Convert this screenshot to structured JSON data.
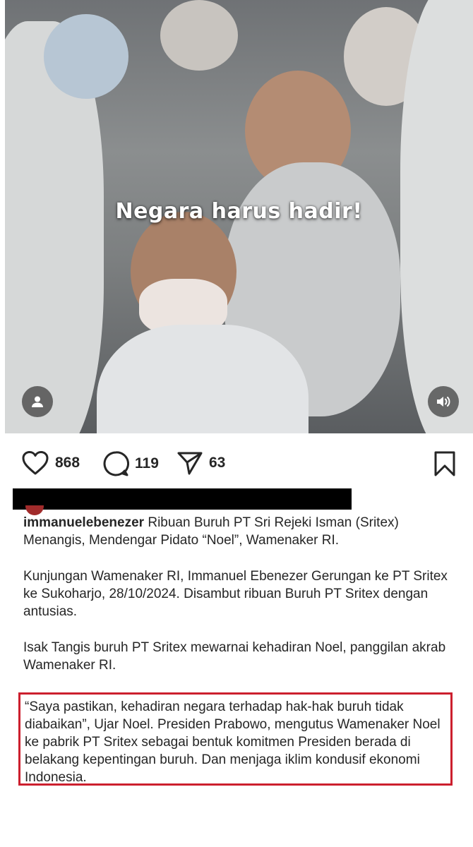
{
  "post": {
    "overlay_text": "Negara harus hadir!",
    "likes": "868",
    "comments": "119",
    "shares": "63"
  },
  "icons": {
    "like": "heart-icon",
    "comment": "comment-icon",
    "share": "send-icon",
    "save": "bookmark-icon",
    "user": "user-icon",
    "audio": "speaker-icon"
  },
  "caption": {
    "username": "immanuelebenezer",
    "text": "Ribuan Buruh PT Sri Rejeki Isman (Sritex) Menangis, Mendengar Pidato “Noel”, Wamenaker RI.",
    "paragraph2": "Kunjungan Wamenaker RI, Immanuel Ebenezer Gerungan ke PT Sritex ke Sukoharjo, 28/10/2024. Disambut ribuan Buruh PT Sritex dengan antusias.",
    "paragraph3": "Isak Tangis buruh PT Sritex mewarnai kehadiran Noel, panggilan akrab Wamenaker RI.",
    "quote": "“Saya pastikan, kehadiran negara terhadap hak-hak buruh tidak diabaikan”, Ujar Noel. Presiden Prabowo, mengutus Wamenaker Noel ke pabrik PT Sritex sebagai bentuk komitmen Presiden berada di belakang kepentingan buruh. Dan menjaga iklim kondusif ekonomi Indonesia."
  },
  "colors": {
    "highlight_border": "#cc1f2e",
    "text": "#262626"
  }
}
